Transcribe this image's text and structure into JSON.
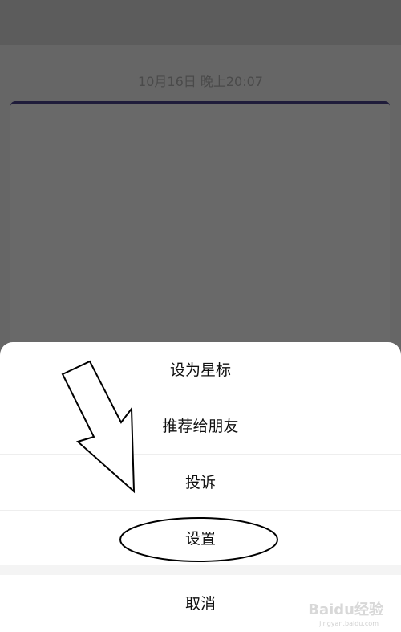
{
  "header": {
    "timestamp": "10月16日 晚上20:07"
  },
  "menu": {
    "items": [
      {
        "label": "设为星标"
      },
      {
        "label": "推荐给朋友"
      },
      {
        "label": "投诉"
      },
      {
        "label": "设置"
      }
    ],
    "cancel_label": "取消"
  },
  "watermark": {
    "brand": "Baidu经验",
    "url": "jingyan.baidu.com"
  },
  "colors": {
    "overlay": "#666666",
    "sheet": "#ffffff",
    "annotation": "#000000"
  }
}
